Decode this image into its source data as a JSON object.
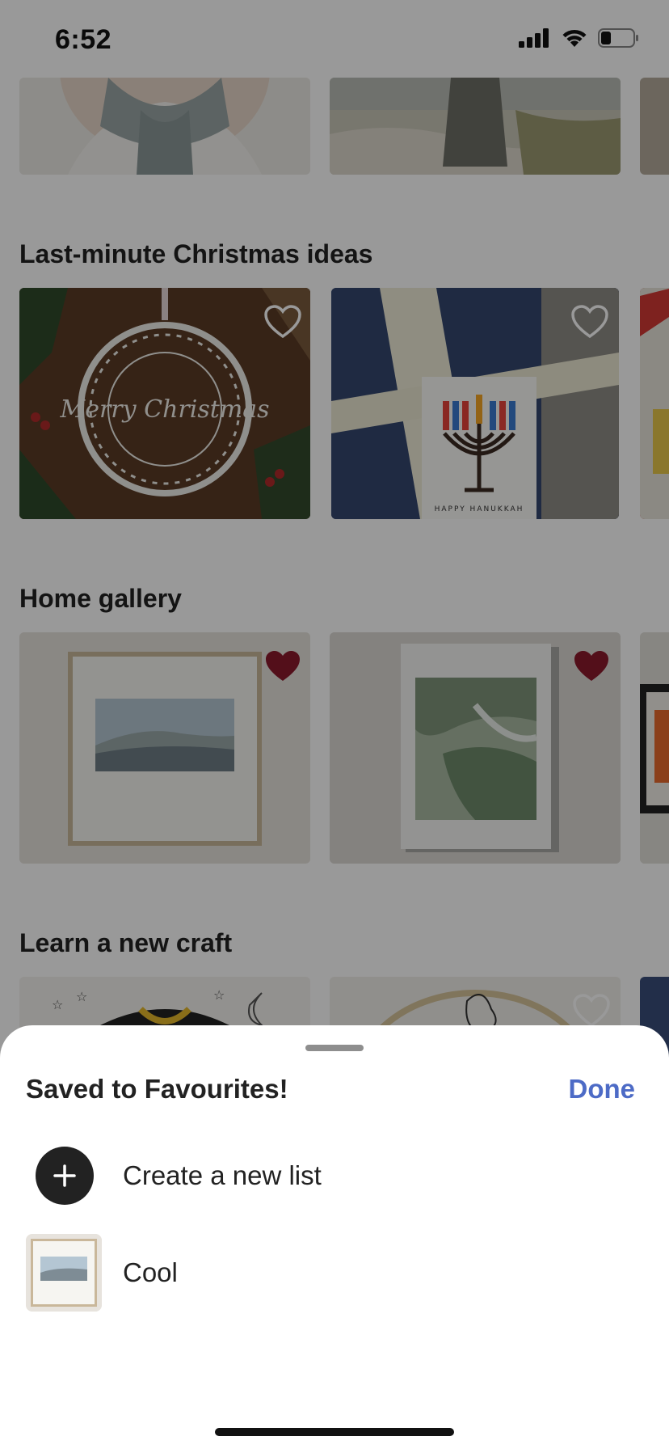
{
  "status": {
    "time": "6:52"
  },
  "sections": [
    {
      "title": "Last-minute Christmas ideas"
    },
    {
      "title": "Home gallery"
    },
    {
      "title": "Learn a new craft"
    }
  ],
  "products": {
    "hanukkah_card_text": "HAPPY HANUKKAH",
    "ornament_text": "Merry Christmas"
  },
  "sheet": {
    "title": "Saved to Favourites!",
    "done_label": "Done",
    "lists": [
      {
        "label": "Create a new list",
        "icon": "plus-icon"
      },
      {
        "label": "Cool",
        "icon": "list-thumbnail"
      }
    ]
  },
  "colors": {
    "accent": "#4d6bc6",
    "favorite": "#8a1a2c",
    "dark": "#222222"
  }
}
